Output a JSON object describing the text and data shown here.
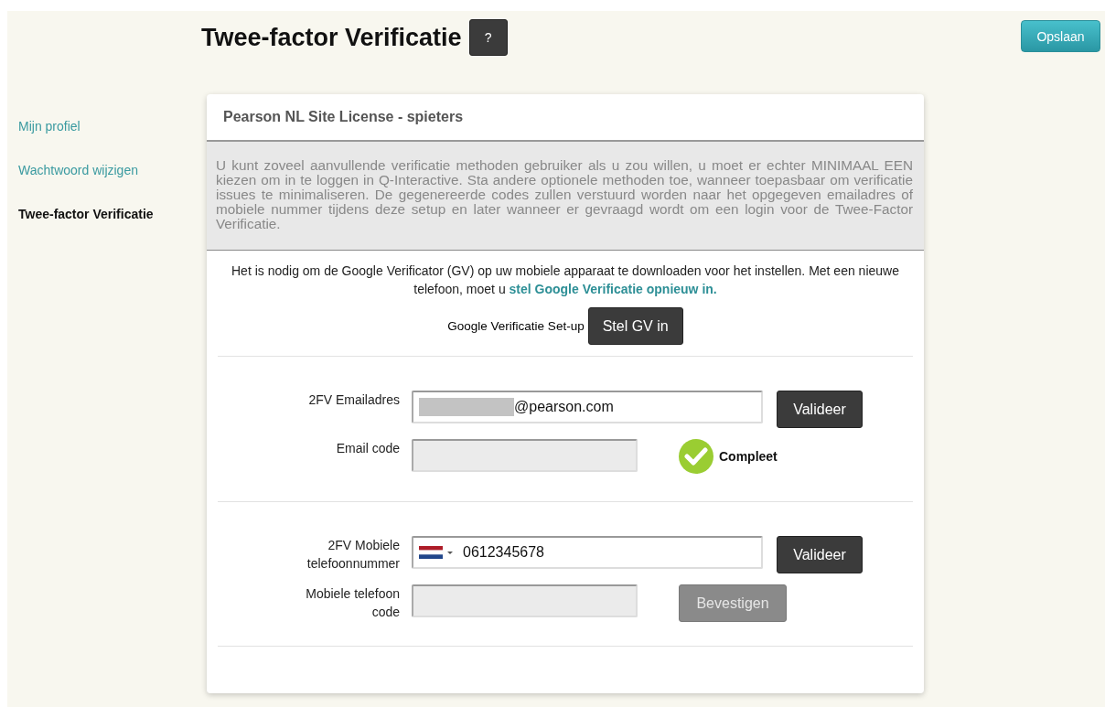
{
  "header": {
    "title": "Twee-factor Verificatie",
    "help_button": "?",
    "save_button": "Opslaan"
  },
  "sidebar": {
    "items": [
      {
        "label": "Mijn profiel",
        "selected": false
      },
      {
        "label": "Wachtwoord wijzigen",
        "selected": false
      },
      {
        "label": "Twee-factor Verificatie",
        "selected": true
      }
    ]
  },
  "card": {
    "title": "Pearson NL Site License - spieters",
    "description": "U kunt zoveel aanvullende verificatie methoden gebruiker als u zou willen, u moet er echter MINIMAAL EEN kiezen om in te loggen in Q-Interactive. Sta andere optionele methoden toe, wanneer toepasbaar om verificatie issues te minimaliseren. De gegenereerde codes zullen verstuurd worden naar het opgegeven emailadres of mobiele nummer tijdens deze setup en later wanneer er gevraagd wordt om een login voor de Twee-Factor Verificatie.",
    "notice": {
      "text": "Het is nodig om de Google Verificator (GV) op uw mobiele apparaat te downloaden voor het instellen. Met een nieuwe telefoon, moet u",
      "link": "stel Google Verificatie opnieuw in."
    },
    "gv_setup": {
      "label": "Google Verificatie Set-up",
      "button": "Stel GV in"
    },
    "sections": [
      {
        "kind": "email",
        "label": "2FV Emailadres",
        "value": "@pearson.com",
        "redacted": true,
        "button": {
          "label": "Valideer",
          "disabled": false
        },
        "code_label": "Email code",
        "status": "Compleet"
      },
      {
        "kind": "phone",
        "label": "2FV Mobiele telefoonnummer",
        "value": "0612345678",
        "redacted": false,
        "button": {
          "label": "Valideer",
          "disabled": false
        },
        "code_label": "Mobiele telefoon code",
        "confirm": {
          "label": "Bevestigen",
          "disabled": true
        }
      }
    ]
  }
}
